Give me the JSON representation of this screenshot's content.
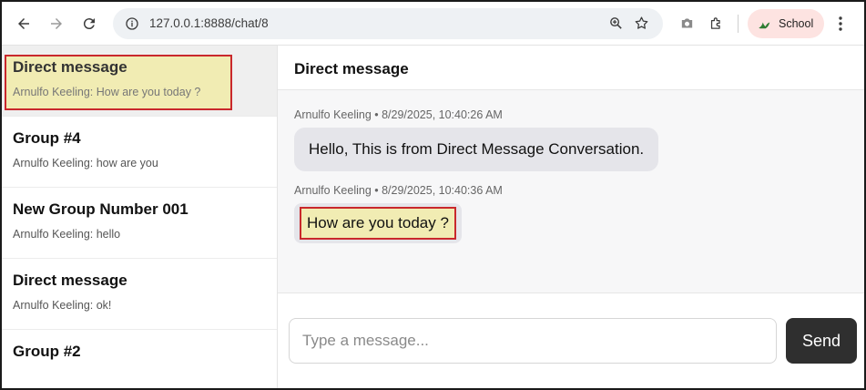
{
  "browser": {
    "url": "127.0.0.1:8888/chat/8",
    "profile_name": "School"
  },
  "sidebar": {
    "items": [
      {
        "title": "Direct message",
        "preview": "Arnulfo Keeling: How are you today ?"
      },
      {
        "title": "Group #4",
        "preview": "Arnulfo Keeling: how are you"
      },
      {
        "title": "New Group Number 001",
        "preview": "Arnulfo Keeling: hello"
      },
      {
        "title": "Direct message",
        "preview": "Arnulfo Keeling: ok!"
      },
      {
        "title": "Group #2",
        "preview": ""
      }
    ]
  },
  "conversation": {
    "title": "Direct message",
    "messages": [
      {
        "meta": "Arnulfo Keeling • 8/29/2025, 10:40:26 AM",
        "text": "Hello, This is from Direct Message Conversation."
      },
      {
        "meta": "Arnulfo Keeling • 8/29/2025, 10:40:36 AM",
        "text": "How are you today ?"
      }
    ]
  },
  "composer": {
    "placeholder": "Type a message...",
    "send_label": "Send"
  }
}
